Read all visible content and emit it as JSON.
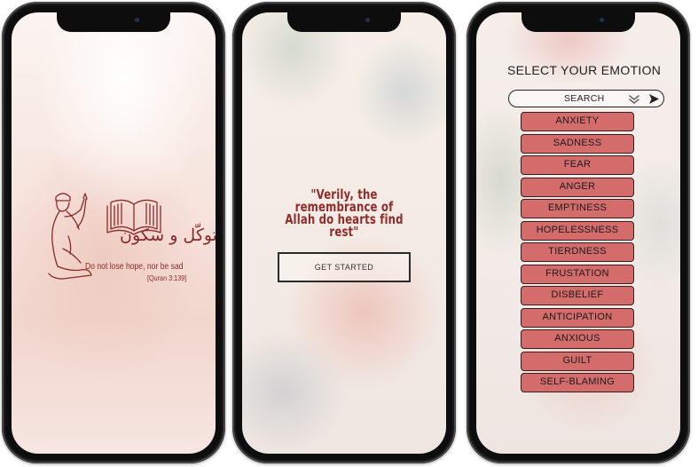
{
  "screens": {
    "splash": {
      "logo_script": "توكّل و سكون",
      "tagline": "Do not lose hope, nor be sad",
      "reference": "[Quran 3:139]"
    },
    "welcome": {
      "quote_line1": "\"Verily, the remembrance of",
      "quote_line2": "Allah do hearts find rest\"",
      "get_started_label": "GET STARTED"
    },
    "emotions": {
      "title": "SELECT YOUR EMOTION",
      "search_label": "SEARCH",
      "items": [
        "ANXIETY",
        "SADNESS",
        "FEAR",
        "ANGER",
        "EMPTINESS",
        "HOPELESSNESS",
        "TIERDNESS",
        "FRUSTATION",
        "DISBELIEF",
        "ANTICIPATION",
        "ANXIOUS",
        "GUILT",
        "SELF-BLAMING"
      ]
    }
  },
  "colors": {
    "accent": "#d46c6c",
    "brand_text": "#8e2b2b",
    "phone_frame": "#1a1a1a"
  },
  "icons": {
    "logo": "praying-person-book-icon",
    "search_dropdown": "chevron-double-down-icon",
    "search_submit": "send-arrow-icon"
  }
}
